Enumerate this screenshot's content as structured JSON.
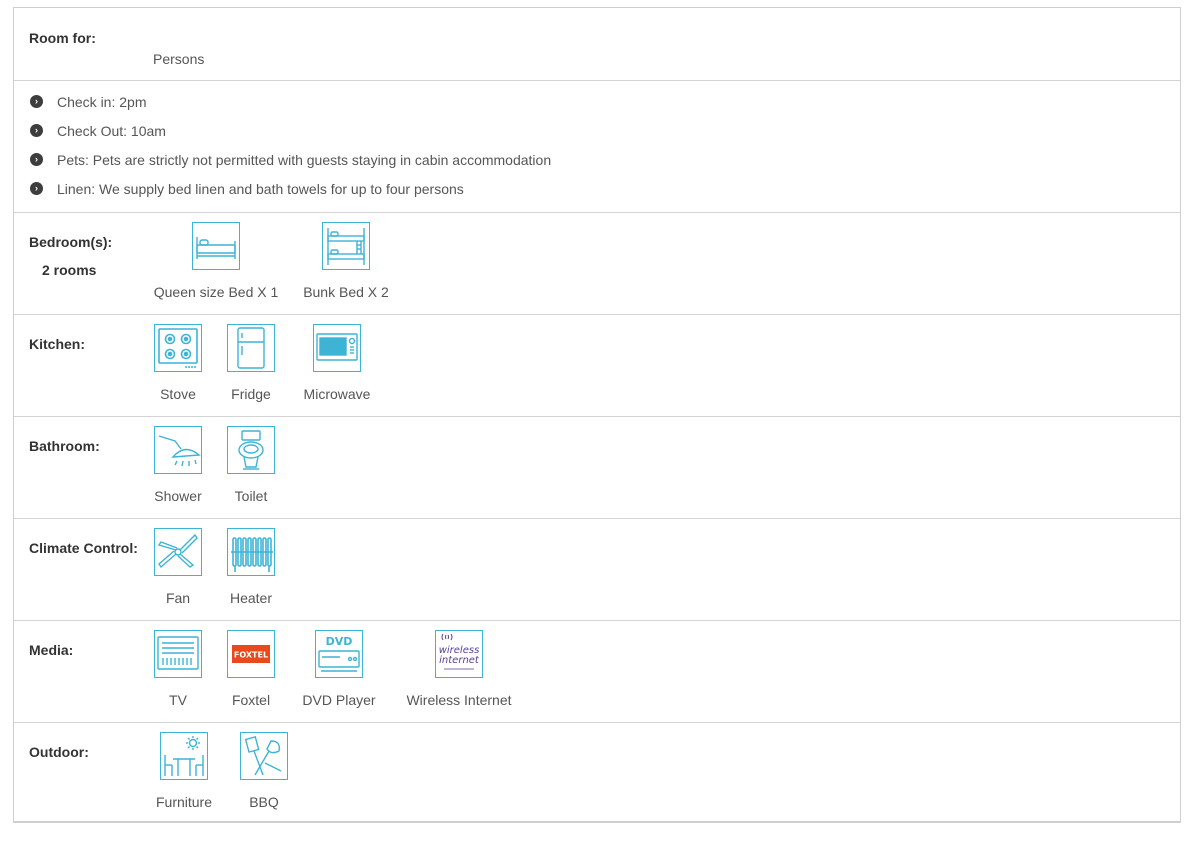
{
  "room_for": {
    "label": "Room for:",
    "persons": "Persons"
  },
  "rules": [
    {
      "text": "Check in: 2pm"
    },
    {
      "text": "Check Out: 10am"
    },
    {
      "text": "Pets: Pets are strictly not permitted with guests staying in cabin accommodation"
    },
    {
      "text": "Linen: We supply bed linen and bath towels for up to four persons"
    }
  ],
  "bedrooms": {
    "label": "Bedroom(s):",
    "count": "2 rooms",
    "items": [
      {
        "label": "Queen size Bed X 1",
        "icon": "queen-bed-icon"
      },
      {
        "label": "Bunk Bed X 2",
        "icon": "bunk-bed-icon"
      }
    ]
  },
  "kitchen": {
    "label": "Kitchen:",
    "items": [
      {
        "label": "Stove",
        "icon": "stove-icon"
      },
      {
        "label": "Fridge",
        "icon": "fridge-icon"
      },
      {
        "label": "Microwave",
        "icon": "microwave-icon"
      }
    ]
  },
  "bathroom": {
    "label": "Bathroom:",
    "items": [
      {
        "label": "Shower",
        "icon": "shower-icon"
      },
      {
        "label": "Toilet",
        "icon": "toilet-icon"
      }
    ]
  },
  "climate": {
    "label": "Climate Control:",
    "items": [
      {
        "label": "Fan",
        "icon": "fan-icon"
      },
      {
        "label": "Heater",
        "icon": "heater-icon"
      }
    ]
  },
  "media": {
    "label": "Media:",
    "items": [
      {
        "label": "TV",
        "icon": "tv-icon"
      },
      {
        "label": "Foxtel",
        "icon": "foxtel-logo-icon"
      },
      {
        "label": "DVD Player",
        "icon": "dvd-player-icon"
      },
      {
        "label": "Wireless Internet",
        "icon": "wireless-internet-icon"
      }
    ]
  },
  "outdoor": {
    "label": "Outdoor:",
    "items": [
      {
        "label": "Furniture",
        "icon": "outdoor-furniture-icon"
      },
      {
        "label": "BBQ",
        "icon": "bbq-icon"
      }
    ]
  },
  "colors": {
    "icon_accent": "#3db4d6",
    "foxtel_brand": "#e8491d",
    "wireless_brand": "#5a3d96"
  },
  "logo_text": {
    "foxtel": "FOXTEL",
    "dvd": "DVD",
    "wireless_line1": "wireless",
    "wireless_line2": "internet"
  }
}
